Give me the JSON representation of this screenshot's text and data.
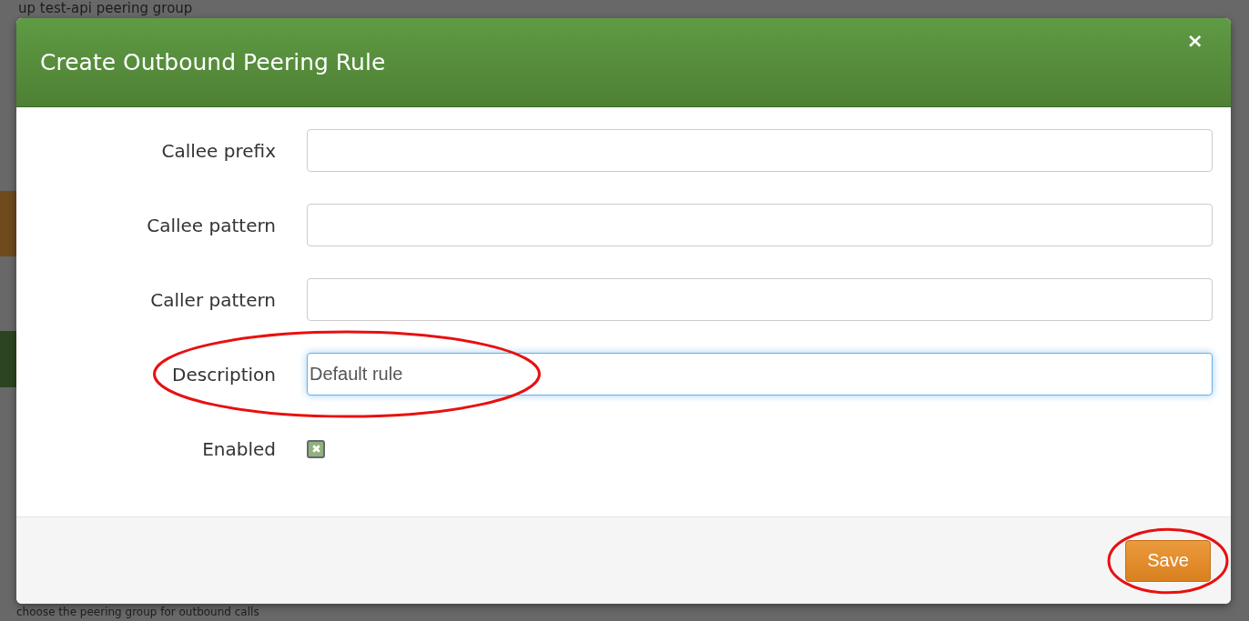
{
  "background": {
    "title": "up test-api peering group",
    "note": "choose the peering group for outbound calls"
  },
  "dialog": {
    "title": "Create Outbound Peering Rule",
    "close": "×",
    "fields": [
      {
        "kind": "text",
        "label": "Callee prefix",
        "focused": false,
        "circled": false
      },
      {
        "kind": "text",
        "label": "Callee pattern",
        "focused": false,
        "circled": false
      },
      {
        "kind": "text",
        "label": "Caller pattern",
        "focused": false,
        "circled": false
      },
      {
        "kind": "text",
        "label": "Description",
        "value": "Default rule",
        "focused": true,
        "circled": true
      },
      {
        "kind": "checkbox",
        "label": "Enabled",
        "checked": true,
        "circled": false
      }
    ],
    "save": {
      "label": "Save",
      "circled": true
    }
  }
}
